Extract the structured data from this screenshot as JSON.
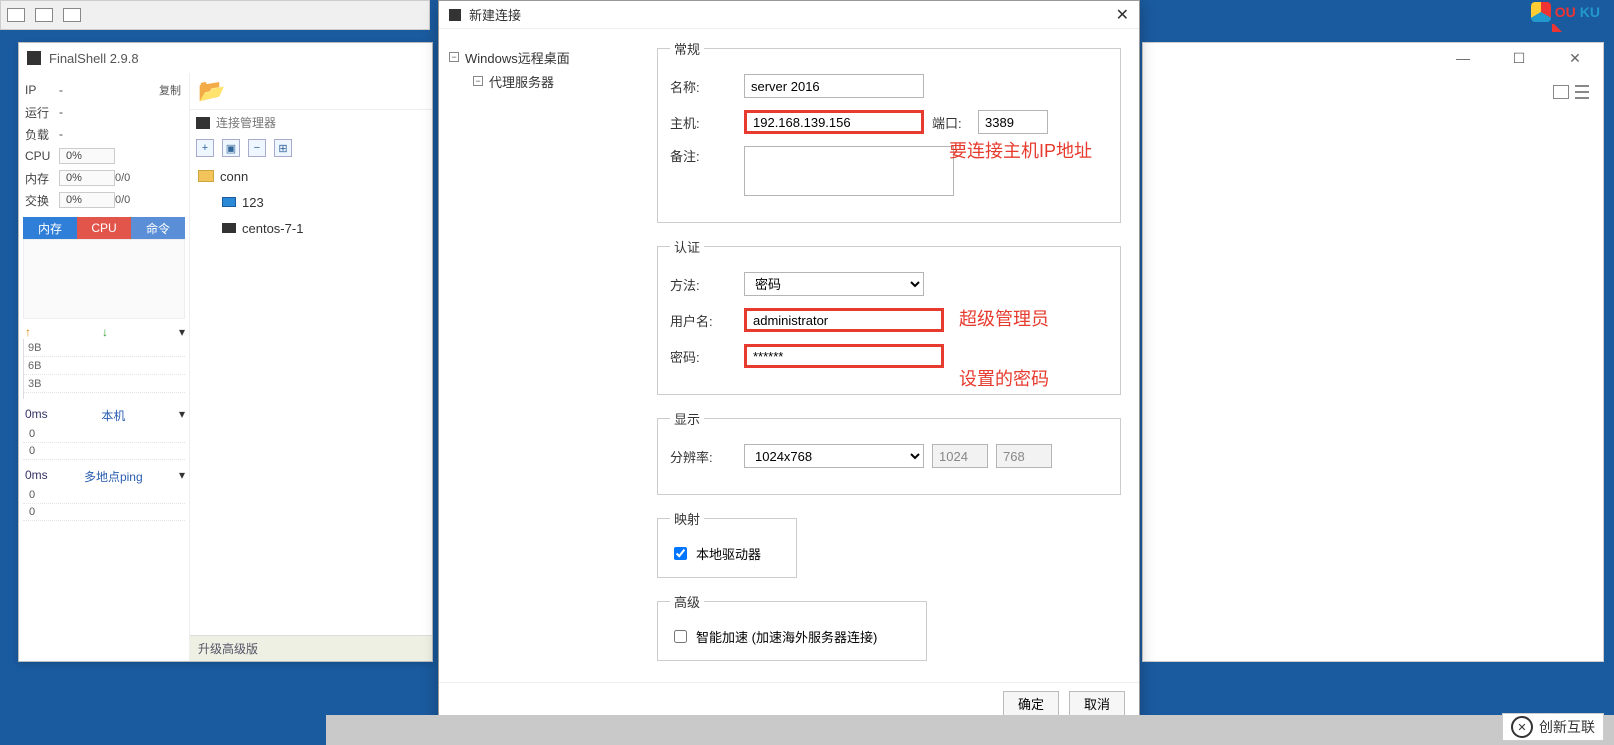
{
  "app": {
    "title": "FinalShell 2.9.8"
  },
  "stats": {
    "ip_label": "IP",
    "ip_val": "-",
    "run_label": "运行",
    "run_val": "-",
    "load_label": "负载",
    "load_val": "-",
    "cpu_label": "CPU",
    "cpu_val": "0%",
    "mem_label": "内存",
    "mem_val": "0%",
    "mem_rt": "0/0",
    "swap_label": "交换",
    "swap_val": "0%",
    "swap_rt": "0/0",
    "copy": "复制"
  },
  "tabs": {
    "mem": "内存",
    "cpu": "CPU",
    "cmd": "命令"
  },
  "mini_chart": {
    "rows": [
      "9B",
      "6B",
      "3B"
    ]
  },
  "sec1": {
    "left": "0ms",
    "right": "本机",
    "rows": [
      "0",
      "0"
    ]
  },
  "sec2": {
    "left": "0ms",
    "right": "多地点ping",
    "rows": [
      "0",
      "0"
    ]
  },
  "conn_mgr": {
    "title": "连接管理器",
    "tree": {
      "root": "conn",
      "children": [
        "123",
        "centos-7-1"
      ]
    },
    "upgrade": "升级高级版"
  },
  "dialog": {
    "title": "新建连接",
    "tree": {
      "root": "Windows远程桌面",
      "child": "代理服务器"
    },
    "groups": {
      "general": {
        "legend": "常规",
        "name_label": "名称:",
        "name_val": "server 2016",
        "host_label": "主机:",
        "host_val": "192.168.139.156",
        "port_label": "端口:",
        "port_val": "3389",
        "note_label": "备注:",
        "note_val": ""
      },
      "auth": {
        "legend": "认证",
        "method_label": "方法:",
        "method_val": "密码",
        "user_label": "用户名:",
        "user_val": "administrator",
        "pass_label": "密码:",
        "pass_val": "******"
      },
      "display": {
        "legend": "显示",
        "res_label": "分辨率:",
        "res_val": "1024x768",
        "w_val": "1024",
        "h_val": "768"
      },
      "map": {
        "legend": "映射",
        "local_drive": "本地驱动器",
        "local_drive_checked": true
      },
      "adv": {
        "legend": "高级",
        "accel": "智能加速 (加速海外服务器连接)",
        "accel_checked": false
      }
    },
    "annotations": {
      "host": "要连接主机IP地址",
      "user": "超级管理员",
      "pass": "设置的密码"
    },
    "buttons": {
      "ok": "确定",
      "cancel": "取消"
    }
  },
  "ouku": {
    "brand1": "OU",
    "brand2": "KU"
  },
  "watermark": {
    "text": "创新互联"
  }
}
